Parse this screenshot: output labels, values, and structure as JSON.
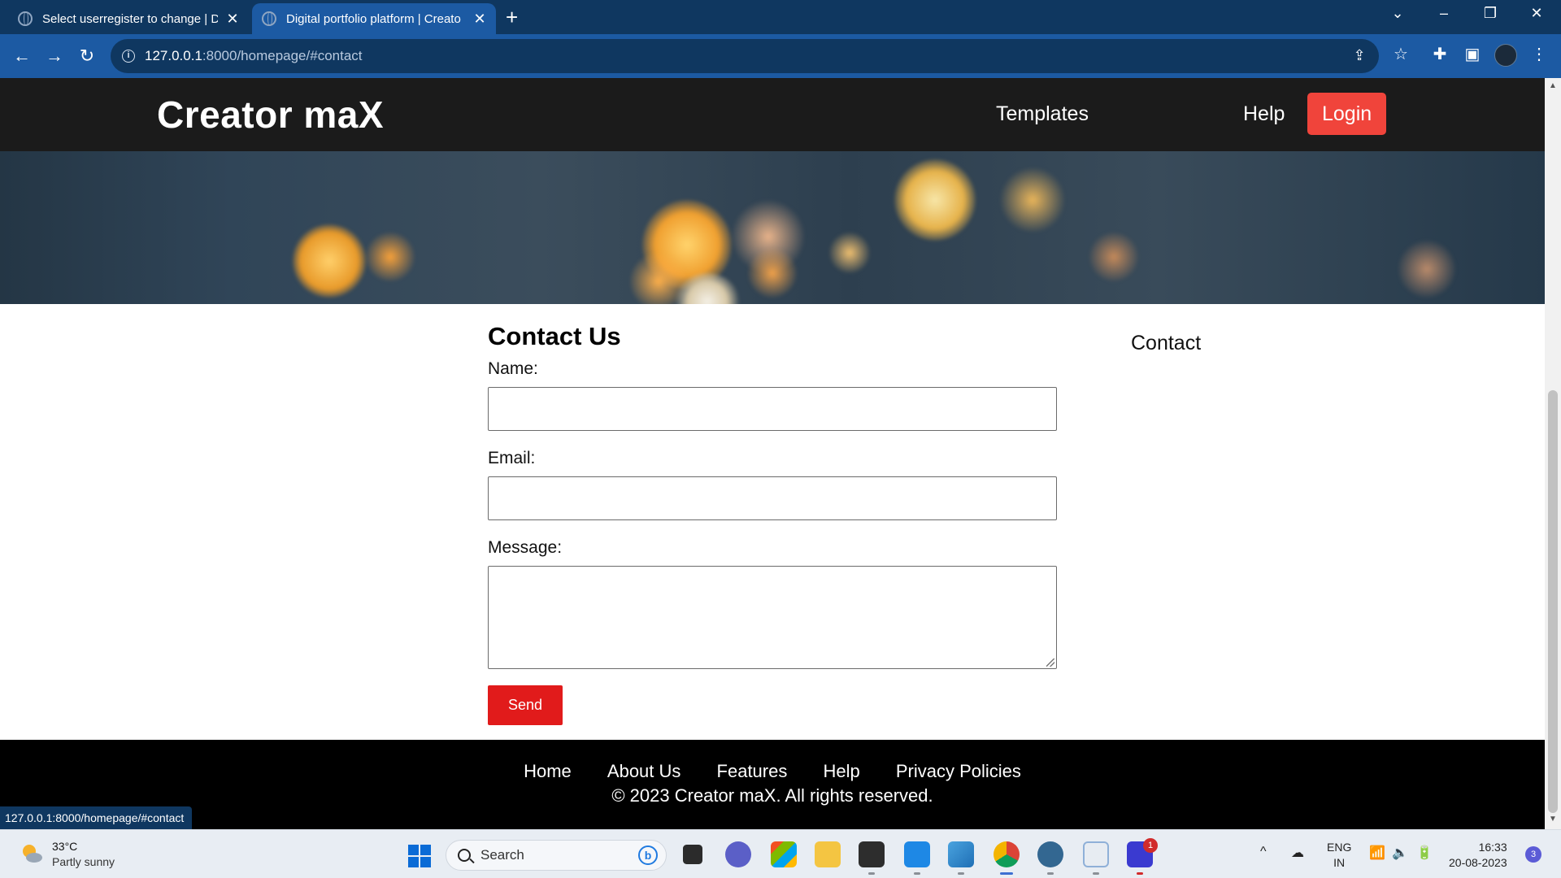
{
  "browser": {
    "tabs": [
      {
        "title": "Select userregister to change | Dj",
        "close": "✕"
      },
      {
        "title": "Digital portfolio platform | Creato",
        "close": "✕"
      }
    ],
    "new_tab": "+",
    "address": {
      "host": "127.0.0.1",
      "path": ":8000/homepage/#contact"
    },
    "status_url": "127.0.0.1:8000/homepage/#contact",
    "icons": [
      "back-arrow-icon",
      "forward-arrow-icon",
      "reload-icon",
      "site-info-icon",
      "share-icon",
      "bookmark-star-icon",
      "extensions-icon",
      "side-panel-icon",
      "profile-avatar",
      "menu-kebab-icon",
      "tab-search-icon",
      "minimize-icon",
      "restore-icon",
      "close-window-icon"
    ]
  },
  "site": {
    "brand": "Creator maX",
    "nav": {
      "templates": "Templates",
      "contact": "Contact",
      "help": "Help",
      "login": "Login"
    },
    "colors": {
      "header_bg": "#1b1b1b",
      "login_bg": "#f0443b",
      "send_bg": "#e11b1b",
      "footer_bg": "#000000"
    }
  },
  "contact_form": {
    "heading": "Contact Us",
    "name_label": "Name:",
    "email_label": "Email:",
    "message_label": "Message:",
    "name_value": "",
    "email_value": "",
    "message_value": "",
    "send_label": "Send"
  },
  "footer": {
    "links": [
      "Home",
      "About Us",
      "Features",
      "Help",
      "Privacy Policies"
    ],
    "copyright": "© 2023 Creator maX. All rights reserved."
  },
  "taskbar": {
    "weather": {
      "temp": "33°C",
      "desc": "Partly sunny"
    },
    "search_placeholder": "Search",
    "bing_glyph": "b",
    "badge_count": "1",
    "lang": {
      "line1": "ENG",
      "line2": "IN"
    },
    "clock": {
      "time": "16:33",
      "date": "20-08-2023"
    },
    "notification_count": "3",
    "tray_up": "^"
  }
}
